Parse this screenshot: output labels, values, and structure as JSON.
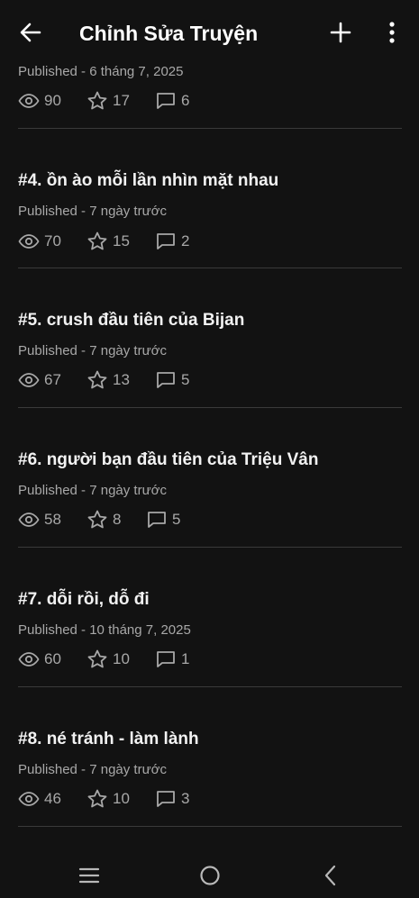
{
  "app_bar": {
    "title": "Chỉnh Sửa Truyện",
    "back_icon": "arrow-left-icon",
    "add_icon": "plus-icon",
    "more_icon": "more-vertical-icon"
  },
  "parts": [
    {
      "title": "",
      "meta": "Published - 6 tháng 7, 2025",
      "views": "90",
      "stars": "17",
      "comments": "6"
    },
    {
      "title": "#4. ồn ào mỗi lần nhìn mặt nhau",
      "meta": "Published - 7 ngày trước",
      "views": "70",
      "stars": "15",
      "comments": "2"
    },
    {
      "title": "#5. crush đầu tiên của Bijan",
      "meta": "Published - 7 ngày trước",
      "views": "67",
      "stars": "13",
      "comments": "5"
    },
    {
      "title": "#6. người bạn đầu tiên của Triệu Vân",
      "meta": "Published - 7 ngày trước",
      "views": "58",
      "stars": "8",
      "comments": "5"
    },
    {
      "title": "#7. dỗi rồi, dỗ đi",
      "meta": "Published - 10 tháng 7, 2025",
      "views": "60",
      "stars": "10",
      "comments": "1"
    },
    {
      "title": "#8. né tránh - làm lành",
      "meta": "Published - 7 ngày trước",
      "views": "46",
      "stars": "10",
      "comments": "3"
    }
  ],
  "colors": {
    "background": "#121212",
    "text_primary": "#f2f2f2",
    "text_secondary": "#a8a8a8",
    "divider": "#3a3a3a"
  },
  "nav_bar": {
    "recents_icon": "recents-icon",
    "home_icon": "home-circle-icon",
    "back_icon": "nav-back-icon"
  }
}
